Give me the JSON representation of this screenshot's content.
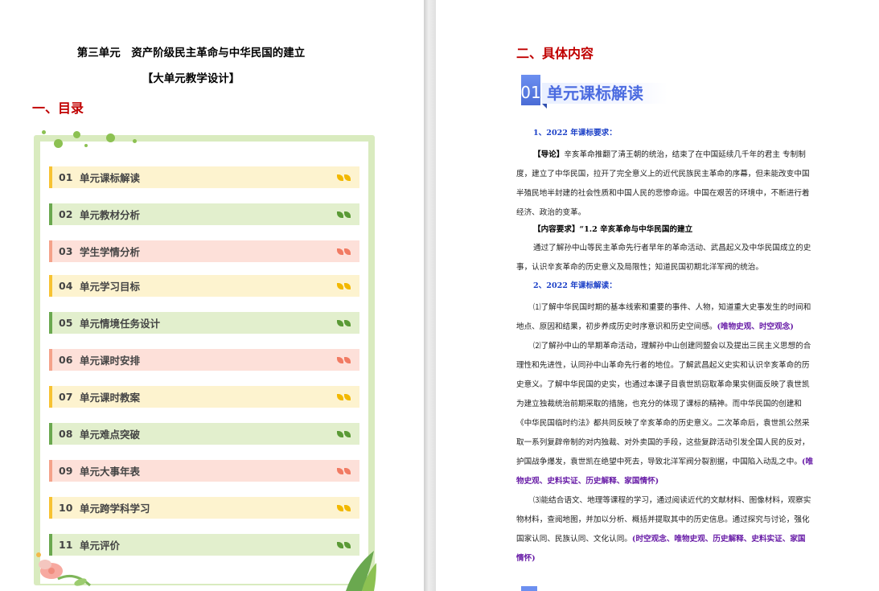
{
  "left": {
    "unit_title": "第三单元　资产阶级民主革命与中华民国的建立",
    "subtitle": "【大单元教学设计】",
    "heading": "一、目录",
    "toc": [
      {
        "num": "01",
        "label": "单元课标解读",
        "color": "yellow"
      },
      {
        "num": "02",
        "label": "单元教材分析",
        "color": "green"
      },
      {
        "num": "03",
        "label": "学生学情分析",
        "color": "pink"
      },
      {
        "num": "04",
        "label": "单元学习目标",
        "color": "yellow"
      },
      {
        "num": "05",
        "label": "单元情境任务设计",
        "color": "green"
      },
      {
        "num": "06",
        "label": "单元课时安排",
        "color": "pink"
      },
      {
        "num": "07",
        "label": "单元课时教案",
        "color": "yellow"
      },
      {
        "num": "08",
        "label": "单元难点突破",
        "color": "green"
      },
      {
        "num": "09",
        "label": "单元大事年表",
        "color": "pink"
      },
      {
        "num": "10",
        "label": "单元跨学科学习",
        "color": "yellow"
      },
      {
        "num": "11",
        "label": "单元评价",
        "color": "green"
      }
    ]
  },
  "right": {
    "heading": "二、具体内容",
    "banner_num": "01",
    "banner_title": "单元课标解读",
    "req_title": "1、2022 年课标要求：",
    "intro_tag": "【导论】",
    "intro_lines": [
      "辛亥革命推翻了清王朝的统治，结束了在中国延续几千年的君主  专制制",
      "度，建立了中华民国，拉开了完全意义上的近代民族民主革命的序幕，但未能改变中国",
      "半殖民地半封建的社会性质和中国人民的悲惨命运。中国在艰苦的环境中，不断进行着",
      "经济、政治的变革。"
    ],
    "content_req": "【内容要求】“1.2  辛亥革命与中华民国的建立",
    "content_lines": [
      "通过了解孙中山等民主革命先行者早年的革命活动、武昌起义及中华民国成立的史",
      "事，认识辛亥革命的历史意义及局限性；知道民国初期北洋军阀的统治。"
    ],
    "interp_title": "2、2022 年课标解读：",
    "p1_lines": [
      "⑴了解中华民国时期的基本线索和重要的事件、人物，知道重大史事发生的时间和",
      "地点、原因和结果，初步养成历史时序意识和历史空间感。"
    ],
    "p1_tag": "(唯物史观、时空观念)",
    "p2_lines": [
      "⑵了解孙中山的早期革命活动，理解孙中山创建同盟会以及提出三民主义思想的合",
      "理性和先进性，认同孙中山革命先行者的地位。了解武昌起义史实和认识辛亥革命的历",
      "史意义。了解中华民国的史实，也通过本课子目袁世凯窃取革命果实侧面反映了袁世凯",
      "为建立独裁统治前期采取的措施，也充分的体现了课标的精神。而中华民国的创建和",
      "《中华民国临时约法》都共同反映了辛亥革命的历史意义。二次革命后，袁世凯公然采",
      "取一系列复辟帝制的对内独裁、对外卖国的手段，这些复辟活动引发全国人民的反对，",
      "护国战争爆发，袁世凯在绝望中死去，导致北洋军阀分裂割据，中国陷入动乱之中。"
    ],
    "p2_tag_a": "(唯",
    "p2_tag_b": "物史观、史料实证、历史解释、家国情怀)",
    "p3_lines": [
      "⑶能结合语文、地理等课程的学习，通过阅读近代的文献材料、图像材料，观察实",
      "物材料，查阅地图，并加以分析、概括并提取其中的历史信息。通过探究与讨论，强化",
      "国家认同、民族认同、文化认同。"
    ],
    "p3_tag_a": "(时空观念、唯物史观、历史解释、史料实证、家国",
    "p3_tag_b": "情怀)"
  },
  "colors": {
    "heading_red": "#c00000",
    "blue": "#1a3fc7",
    "purple": "#6a1fa8"
  }
}
